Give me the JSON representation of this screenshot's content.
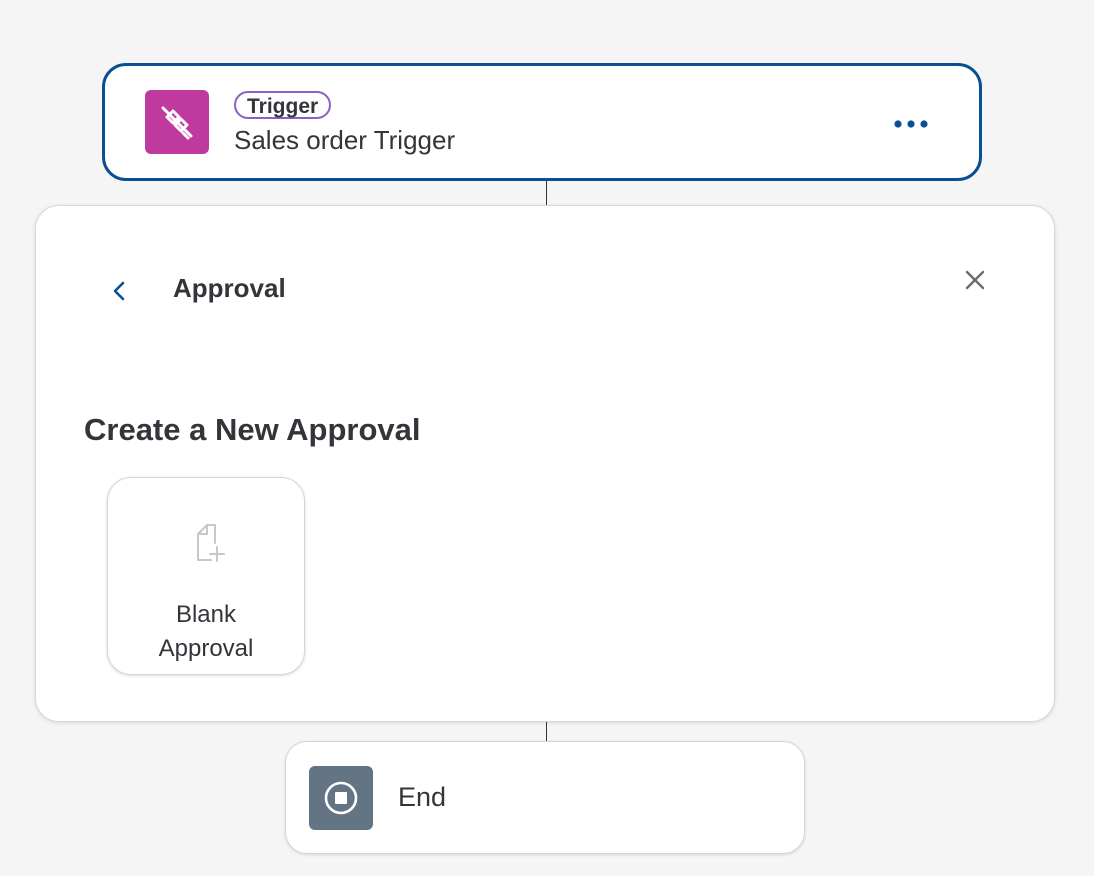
{
  "trigger": {
    "badge": "Trigger",
    "title": "Sales order Trigger",
    "icon": "plug-disconnected-icon",
    "more_icon": "more-icon"
  },
  "panel": {
    "title": "Approval",
    "back_icon": "chevron-left-icon",
    "close_icon": "close-icon",
    "section_heading": "Create a New Approval",
    "templates": [
      {
        "label_line1": "Blank",
        "label_line2": "Approval",
        "icon": "document-add-icon"
      }
    ]
  },
  "end": {
    "label": "End",
    "icon": "stop-icon"
  },
  "colors": {
    "accent": "#0a4e94",
    "trigger_icon_bg": "#c0399f",
    "badge_border": "#8a5fc6",
    "end_icon_bg": "#637484",
    "canvas_bg": "#f5f5f5"
  }
}
